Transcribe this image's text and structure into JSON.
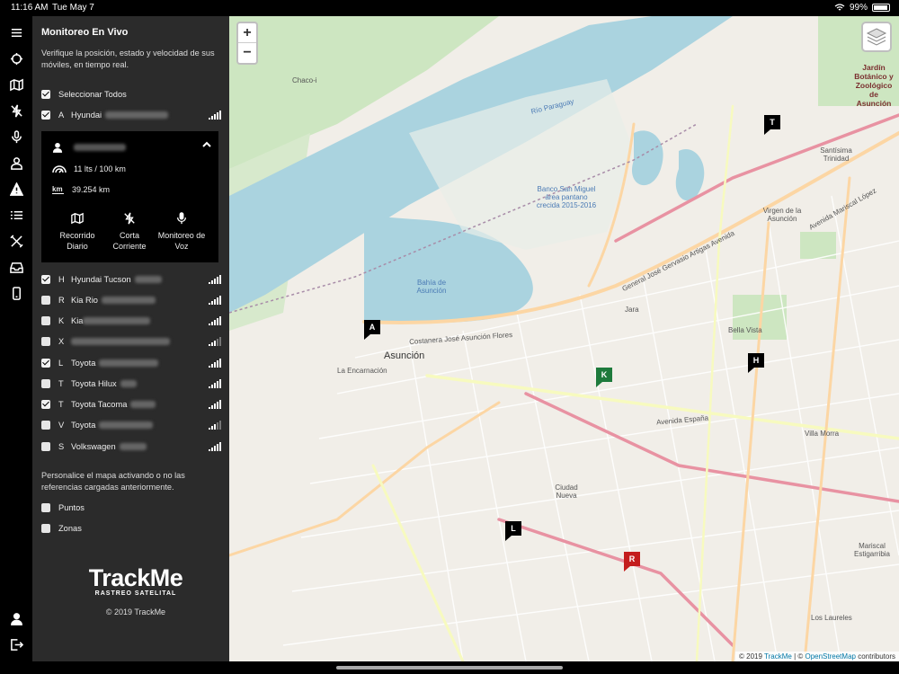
{
  "statusbar": {
    "time": "11:16 AM",
    "date": "Tue May 7",
    "battery": "99%"
  },
  "panel": {
    "title": "Monitoreo En Vivo",
    "description": "Verifique la posición, estado y velocidad de sus móviles, en tiempo real.",
    "select_all": "Seleccionar Todos",
    "vehicles": [
      {
        "letter": "A",
        "name": "Hyundai",
        "checked": true,
        "signal": "strong"
      },
      {
        "letter": "H",
        "name": "Hyundai Tucson",
        "checked": true,
        "signal": "strong"
      },
      {
        "letter": "R",
        "name": "Kia Rio",
        "checked": false,
        "signal": "strong"
      },
      {
        "letter": "K",
        "name": "Kia",
        "checked": false,
        "signal": "strong"
      },
      {
        "letter": "X",
        "name": "",
        "checked": false,
        "signal": "weak"
      },
      {
        "letter": "L",
        "name": "Toyota",
        "checked": true,
        "signal": "strong"
      },
      {
        "letter": "T",
        "name": "Toyota Hilux",
        "checked": false,
        "signal": "strong"
      },
      {
        "letter": "T",
        "name": "Toyota Tacoma",
        "checked": true,
        "signal": "strong"
      },
      {
        "letter": "V",
        "name": "Toyota",
        "checked": false,
        "signal": "weak"
      },
      {
        "letter": "S",
        "name": "Volkswagen",
        "checked": false,
        "signal": "strong"
      }
    ],
    "detail": {
      "consumption": "11 lts / 100 km",
      "odometer": "39.254 km",
      "actions": [
        {
          "label": "Recorrido Diario",
          "icon": "map-icon"
        },
        {
          "label": "Corta Corriente",
          "icon": "power-cut-icon"
        },
        {
          "label": "Monitoreo de Voz",
          "icon": "microphone-icon"
        }
      ]
    },
    "personalize": "Personalice el mapa activando o no las referencias cargadas anteriormente.",
    "references": [
      {
        "label": "Puntos",
        "checked": false
      },
      {
        "label": "Zonas",
        "checked": false
      }
    ],
    "logo": {
      "brand": "TrackMe",
      "tagline": "RASTREO SATELITAL",
      "copyright": "© 2019 TrackMe"
    }
  },
  "map": {
    "zoom_in": "+",
    "zoom_out": "−",
    "attribution_prefix": "© 2019 ",
    "attribution_link1": "TrackMe",
    "attribution_sep": " | © ",
    "attribution_link2": "OpenStreetMap",
    "attribution_suffix": " contributors",
    "labels": {
      "asuncion": "Asunción",
      "chaco": "Chaco-i",
      "bahia": "Bahía de Asunción",
      "jardin": "Jardín Botánico y Zoológico de Asunción",
      "jara": "Jara",
      "bella_vista": "Bella Vista",
      "villa_morra": "Villa Morra",
      "ciudad_nueva": "Ciudad Nueva",
      "banco": "Banco San Miguel área pantano crecida 2015-2016",
      "encarnacion": "La Encarnación",
      "los_laureles": "Los Laureles",
      "santisima": "Santísima Trinidad",
      "virgen": "Virgen de la Asunción",
      "mcal_estigarribia": "Mariscal Estigarribia",
      "rio_paraguay": "Río Paraguay",
      "costanera": "Costanera José Asunción Flores",
      "av_espana": "Avenida España",
      "av_artigas": "General José Gervasio Artigas Avenida",
      "av_mcal_lopez": "Avenida Mariscal López"
    },
    "markers": [
      {
        "letter": "T",
        "color": "#000000"
      },
      {
        "letter": "A",
        "color": "#000000"
      },
      {
        "letter": "K",
        "color": "#1e7a3c"
      },
      {
        "letter": "H",
        "color": "#000000"
      },
      {
        "letter": "L",
        "color": "#000000"
      },
      {
        "letter": "R",
        "color": "#c41d1d"
      }
    ]
  },
  "rail_icons": [
    "menu-icon",
    "crosshair-icon",
    "map-book-icon",
    "power-cut-icon",
    "microphone-icon",
    "driver-icon",
    "alert-icon",
    "list-icon",
    "tools-icon",
    "inbox-icon",
    "phone-icon",
    "user-icon",
    "logout-icon"
  ]
}
